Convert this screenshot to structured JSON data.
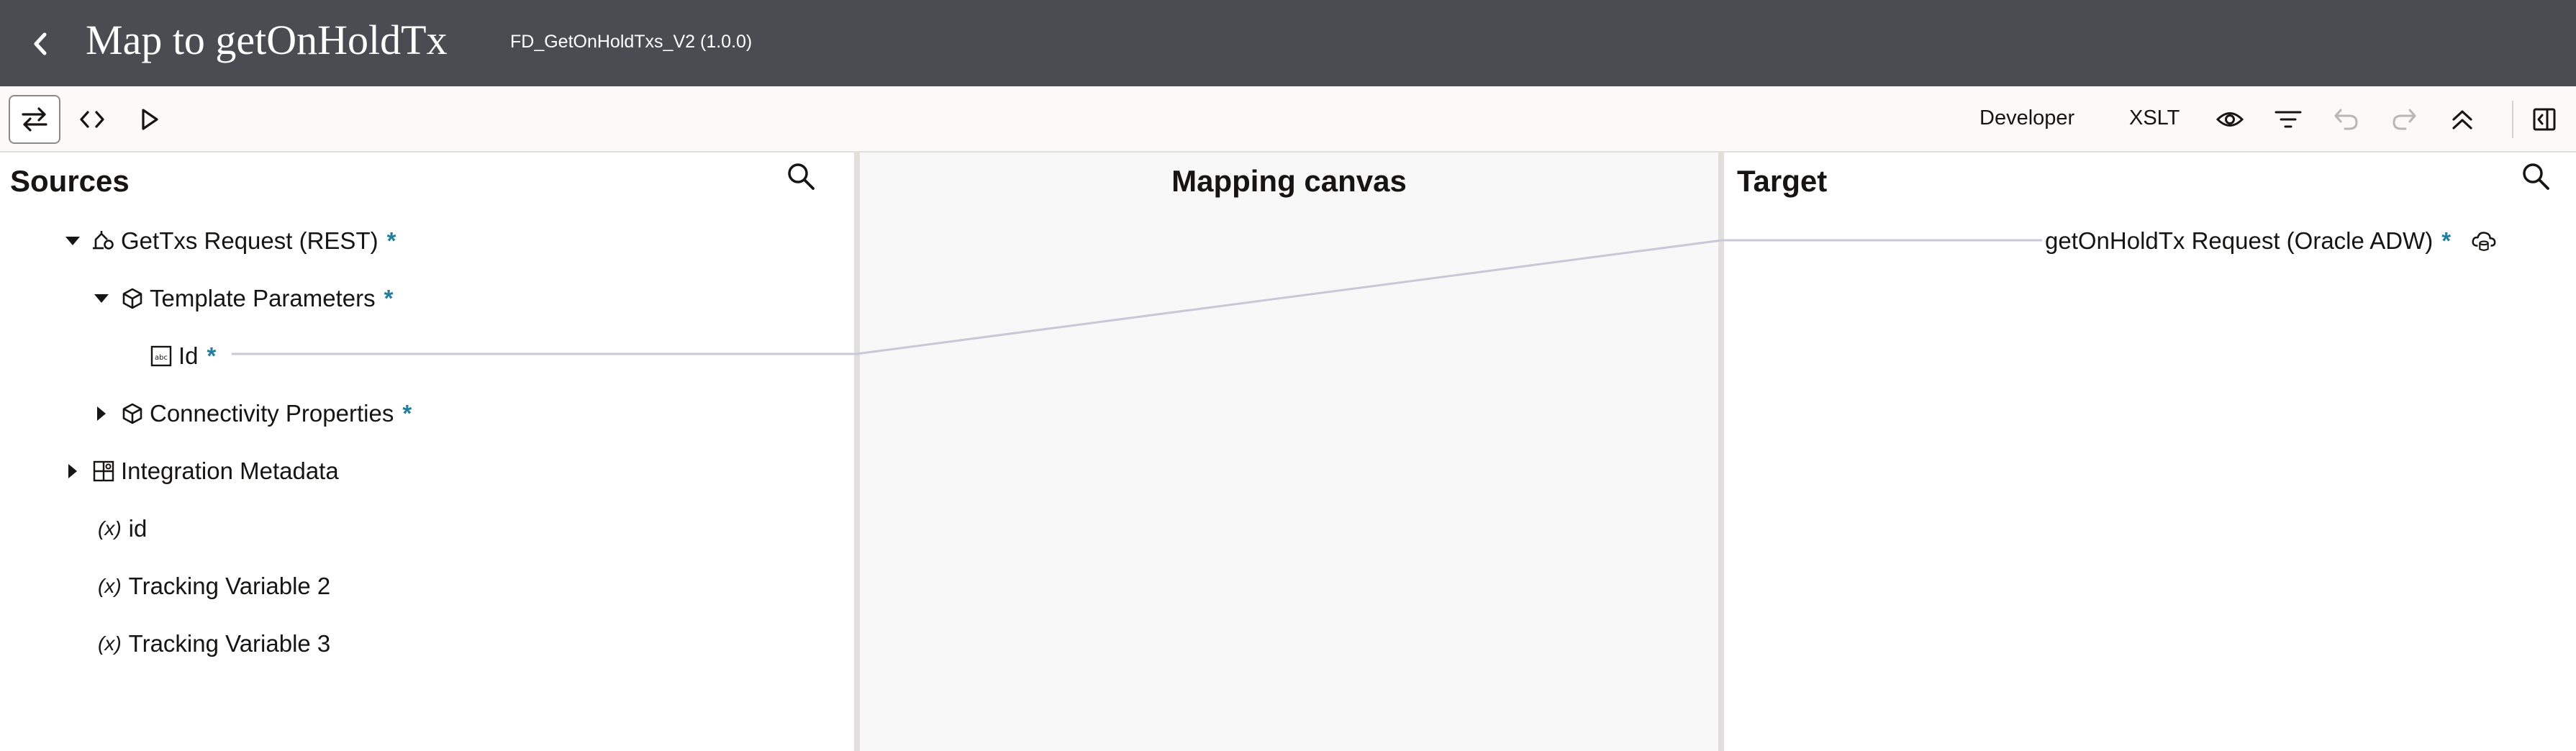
{
  "header": {
    "title": "Map to getOnHoldTx",
    "subtitle": "FD_GetOnHoldTxs_V2 (1.0.0)"
  },
  "toolbar": {
    "developer_label": "Developer",
    "xslt_label": "XSLT"
  },
  "sources": {
    "title": "Sources",
    "tree": {
      "root_label": "GetTxs Request (REST)",
      "template_params_label": "Template Parameters",
      "id_label": "Id",
      "connectivity_label": "Connectivity Properties",
      "integration_metadata_label": "Integration Metadata",
      "var_id_label": "id",
      "tracking2_label": "Tracking Variable 2",
      "tracking3_label": "Tracking Variable 3",
      "required_mark": "*",
      "var_icon_text": "(x)"
    }
  },
  "canvas": {
    "title": "Mapping canvas"
  },
  "target": {
    "title": "Target",
    "root_label": "getOnHoldTx Request (Oracle ADW)",
    "required_mark": "*"
  },
  "colors": {
    "header_bg": "#4a4c52",
    "required_accent": "#227e9e",
    "mapping_line": "#c9c8d8"
  },
  "icons": [
    "chevron-left-icon",
    "swap-icon",
    "code-icon",
    "play-icon",
    "eye-icon",
    "filter-icon",
    "undo-icon",
    "redo-icon",
    "collapse-all-icon",
    "panel-toggle-icon",
    "search-icon",
    "rest-endpoint-icon",
    "cube-icon",
    "string-field-icon",
    "metadata-grid-icon",
    "cloud-database-icon"
  ]
}
